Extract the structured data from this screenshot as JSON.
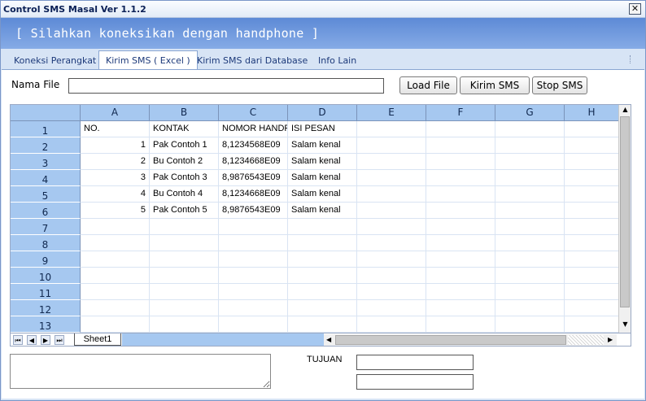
{
  "window": {
    "title": "Control SMS Masal Ver 1.1.2",
    "close_glyph": "✕"
  },
  "banner": {
    "message": "[ Silahkan koneksikan dengan handphone ]"
  },
  "tabs": [
    {
      "label": "Koneksi Perangkat",
      "active": false
    },
    {
      "label": "Kirim SMS ( Excel )",
      "active": true
    },
    {
      "label": "Kirim SMS dari Database",
      "active": false
    },
    {
      "label": "Info Lain",
      "active": false
    }
  ],
  "file": {
    "label": "Nama File",
    "value": ""
  },
  "buttons": {
    "load": "Load File",
    "send": "Kirim SMS",
    "stop": "Stop SMS"
  },
  "sheet": {
    "columns": [
      "A",
      "B",
      "C",
      "D",
      "E",
      "F",
      "G",
      "H"
    ],
    "row_numbers": [
      "1",
      "2",
      "3",
      "4",
      "5",
      "6",
      "7",
      "8",
      "9",
      "10",
      "11",
      "12",
      "13"
    ],
    "rows": [
      [
        "NO.",
        "KONTAK",
        "NOMOR HANDPHONE",
        "ISI PESAN",
        "",
        "",
        "",
        ""
      ],
      [
        "1",
        "Pak Contoh 1",
        "8,1234568E09",
        "Salam kenal",
        "",
        "",
        "",
        ""
      ],
      [
        "2",
        "Bu Contoh 2",
        "8,1234668E09",
        "Salam kenal",
        "",
        "",
        "",
        ""
      ],
      [
        "3",
        "Pak Contoh 3",
        "8,9876543E09",
        "Salam kenal",
        "",
        "",
        "",
        ""
      ],
      [
        "4",
        "Bu Contoh 4",
        "8,1234668E09",
        "Salam kenal",
        "",
        "",
        "",
        ""
      ],
      [
        "5",
        "Pak Contoh 5",
        "8,9876543E09",
        "Salam kenal",
        "",
        "",
        "",
        ""
      ]
    ],
    "sheet_tab": "Sheet1",
    "nav_glyphs": [
      "⏮",
      "◀",
      "▶",
      "⏭"
    ],
    "scroll_glyphs": {
      "up": "▲",
      "down": "▼",
      "left": "◀",
      "right": "▶"
    }
  },
  "bottom": {
    "message_value": "",
    "tujuan_label": "TUJUAN",
    "tujuan_values": [
      "",
      ""
    ]
  },
  "colors": {
    "banner": "#6f99dd",
    "header": "#a6c8f0",
    "window": "#d7e4f5"
  }
}
